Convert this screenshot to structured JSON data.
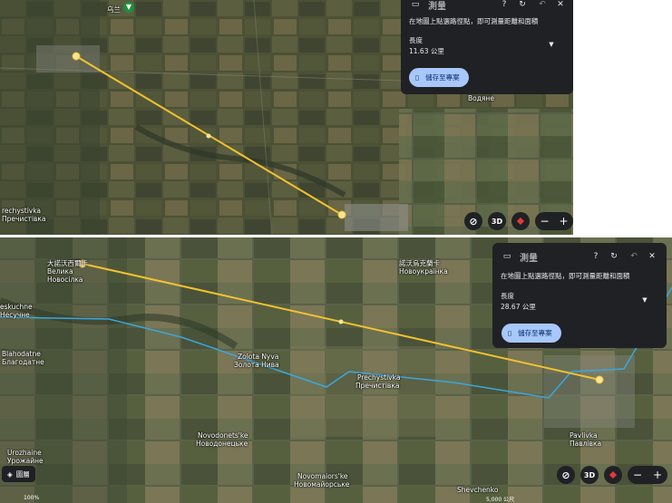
{
  "panel_common": {
    "title": "測量",
    "hint": "在地圖上點選路徑點，即可測量距離和面積",
    "length_label": "長度",
    "save_label": "儲存至專案"
  },
  "top": {
    "length_value": "11.63 公里",
    "places": [
      {
        "name": "Водяне"
      },
      {
        "name": "rechystivka"
      },
      {
        "name": "Пречистівка"
      },
      {
        "name": "乌兰"
      }
    ]
  },
  "bottom": {
    "length_value": "28.67 公里",
    "places": [
      {
        "name": "大諾沃西爾卡"
      },
      {
        "name": "Велика"
      },
      {
        "name": "Новосілка"
      },
      {
        "name": "諾沃烏克蘭卡"
      },
      {
        "name": "Новоукраїнка"
      },
      {
        "name": "eskuchne"
      },
      {
        "name": "Несучне"
      },
      {
        "name": "Blahodatne"
      },
      {
        "name": "Благодатне"
      },
      {
        "name": "Zolota Nyva"
      },
      {
        "name": "Золота Нива"
      },
      {
        "name": "Prechystivka"
      },
      {
        "name": "Пречистівка"
      },
      {
        "name": "Novodonets'ke"
      },
      {
        "name": "Новодонецьке"
      },
      {
        "name": "Urozhaine"
      },
      {
        "name": "Урожайне"
      },
      {
        "name": "Pavlivka"
      },
      {
        "name": "Павлівка"
      },
      {
        "name": "Novomaiors'ke"
      },
      {
        "name": "Новомайорське"
      },
      {
        "name": "Shevchenko"
      }
    ],
    "layer_label": "圖層",
    "scale_text": "5,000 公尺",
    "status_left": "100%"
  },
  "controls": {
    "three_d": "3D"
  },
  "colors": {
    "measure_line": "#f2c230",
    "route_line": "#3aa7e0",
    "panel_bg": "#202124",
    "save_btn": "#a8c7fa"
  }
}
